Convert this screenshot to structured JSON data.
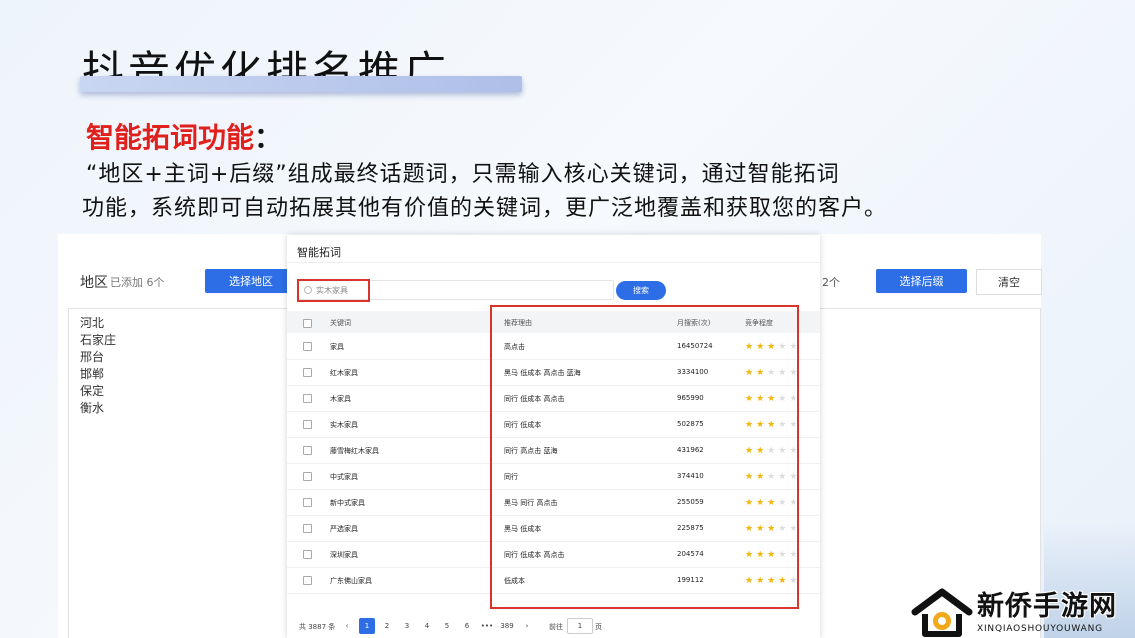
{
  "slide": {
    "title": "抖音优化排名推广",
    "section_heading": "智能拓词功能",
    "section_colon": "：",
    "desc_line1": "“地区+主词+后缀”组成最终话题词，只需输入核心关键词，通过智能拓词",
    "desc_line2": "功能，系统即可自动拓展其他有价值的关键词，更广泛地覆盖和获取您的客户。"
  },
  "background_app": {
    "region_label": "地区",
    "region_added": "已添加 6个",
    "select_region_button": "选择地区",
    "suffix_count": "2个",
    "select_suffix_button": "选择后缀",
    "clear_button": "清空",
    "regions": [
      "河北",
      "石家庄",
      "邢台",
      "邯郸",
      "保定",
      "衡水"
    ]
  },
  "modal": {
    "title": "智能拓词",
    "search_value": "实木家具",
    "search_button": "搜索",
    "columns": {
      "keyword": "关键词",
      "reason": "推荐理由",
      "monthly_search": "月搜索(次)",
      "competition": "竞争程度"
    },
    "rows": [
      {
        "keyword": "家具",
        "reason": "高点击",
        "monthly": "16450724",
        "stars": 3
      },
      {
        "keyword": "红木家具",
        "reason": "黑马 低成本 高点击 蓝海",
        "monthly": "3334100",
        "stars": 2
      },
      {
        "keyword": "木家具",
        "reason": "同行 低成本 高点击",
        "monthly": "965990",
        "stars": 3
      },
      {
        "keyword": "实木家具",
        "reason": "同行 低成本",
        "monthly": "502875",
        "stars": 3
      },
      {
        "keyword": "藤雪梅红木家具",
        "reason": "同行 高点击 蓝海",
        "monthly": "431962",
        "stars": 2
      },
      {
        "keyword": "中式家具",
        "reason": "同行",
        "monthly": "374410",
        "stars": 2
      },
      {
        "keyword": "新中式家具",
        "reason": "黑马 同行 高点击",
        "monthly": "255059",
        "stars": 3
      },
      {
        "keyword": "严选家具",
        "reason": "黑马 低成本",
        "monthly": "225875",
        "stars": 3
      },
      {
        "keyword": "深圳家具",
        "reason": "同行 低成本 高点击",
        "monthly": "204574",
        "stars": 3
      },
      {
        "keyword": "广东佛山家具",
        "reason": "低成本",
        "monthly": "199112",
        "stars": 4
      }
    ],
    "pager": {
      "total": "共 3887 条",
      "prev": "‹",
      "pages": [
        "1",
        "2",
        "3",
        "4",
        "5",
        "6"
      ],
      "ellipsis": "•••",
      "last": "389",
      "next": "›",
      "goto_label": "前往",
      "goto_value": "1",
      "page_suffix": "页"
    }
  },
  "watermark": {
    "name": "新侨手游网",
    "sub": "XINQIAOSHOUYOUWANG"
  },
  "colors": {
    "accent_blue": "#2d6ee6",
    "highlight_red": "#e0201c",
    "star_gold": "#f5b400"
  }
}
